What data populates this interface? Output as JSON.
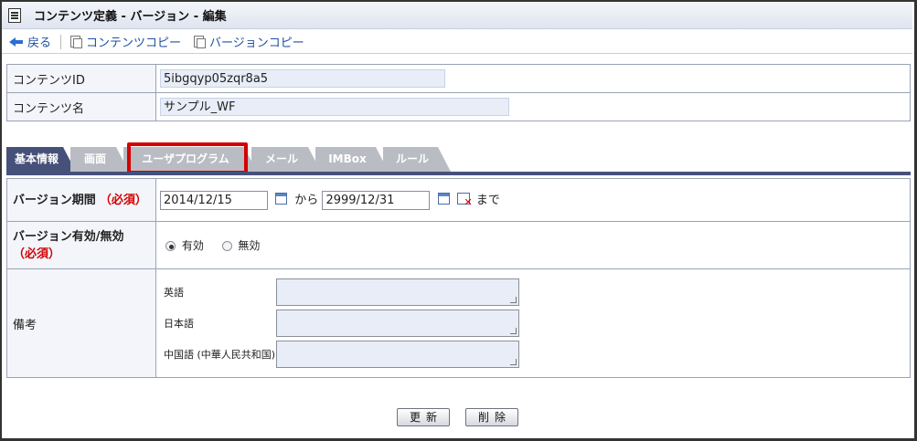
{
  "header": {
    "title": "コンテンツ定義 - バージョン - 編集"
  },
  "toolbar": {
    "back_label": "戻る",
    "content_copy_label": "コンテンツコピー",
    "version_copy_label": "バージョンコピー"
  },
  "content": {
    "id_label": "コンテンツID",
    "id_value": "5ibgqyp05zqr8a5",
    "name_label": "コンテンツ名",
    "name_value": "サンプル_WF"
  },
  "tabs": [
    {
      "label": "基本情報",
      "active": true
    },
    {
      "label": "画面",
      "active": false
    },
    {
      "label": "ユーザプログラム",
      "active": false
    },
    {
      "label": "メール",
      "active": false
    },
    {
      "label": "IMBox",
      "active": false
    },
    {
      "label": "ルール",
      "active": false
    }
  ],
  "version_period": {
    "label": "バージョン期間",
    "required": "（必須）",
    "start": "2014/12/15",
    "from_text": "から",
    "end": "2999/12/31",
    "until_text": "まで"
  },
  "version_enabled": {
    "label": "バージョン有効/無効",
    "required": "（必須）",
    "option_enabled": "有効",
    "option_disabled": "無効",
    "selected": "有効"
  },
  "notes": {
    "label": "備考",
    "lang_en": "英語",
    "lang_ja": "日本語",
    "lang_zh": "中国語 (中華人民共和国)"
  },
  "buttons": {
    "update": "更新",
    "delete": "削除"
  },
  "colors": {
    "active_tab": "#46517a",
    "highlight": "#d40000",
    "required": "#d40000"
  }
}
